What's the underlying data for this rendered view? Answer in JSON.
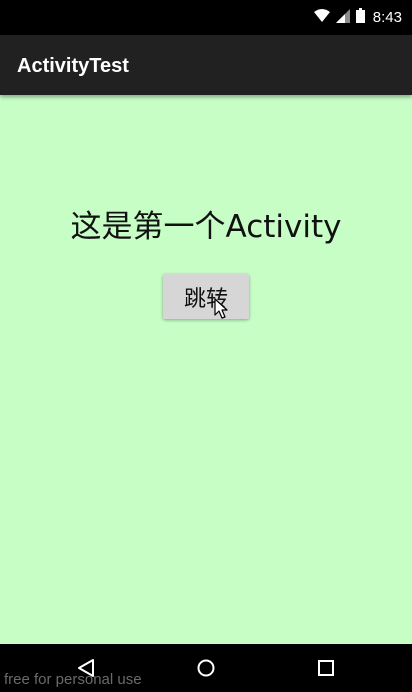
{
  "status_bar": {
    "time": "8:43",
    "icons": [
      "wifi-icon",
      "cellular-signal-icon",
      "battery-icon"
    ]
  },
  "app_bar": {
    "title": "ActivityTest"
  },
  "main": {
    "headline": "这是第一个Activity",
    "button_label": "跳转"
  },
  "nav_bar": {
    "icons": [
      "back-icon",
      "home-icon",
      "recents-icon"
    ]
  },
  "watermark": "free for personal use",
  "colors": {
    "background": "#c6fec6",
    "app_bar": "#212121",
    "status_bar": "#000000",
    "button": "#d6d6d6"
  }
}
